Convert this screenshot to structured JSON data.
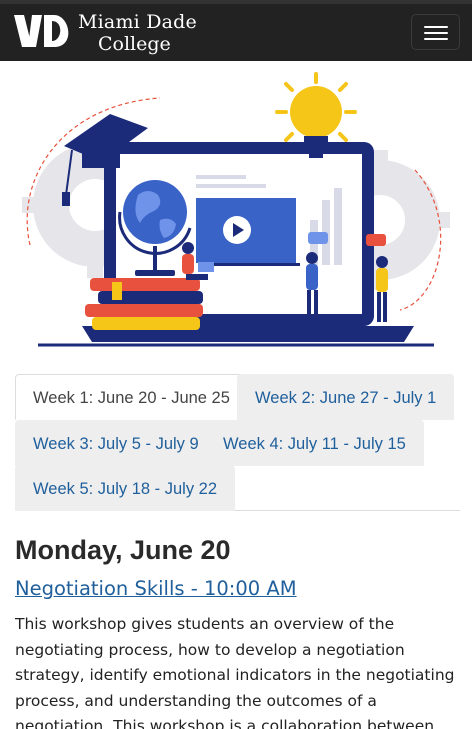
{
  "brand": {
    "name_line1": "Miami Dade",
    "name_line2": "College",
    "logo_icon": "mdc-logo"
  },
  "nav": {
    "toggle_icon": "hamburger-menu-icon"
  },
  "hero": {
    "image_icon": "online-learning-illustration"
  },
  "tabs": [
    {
      "label": "Week 1: June 20 - June 25",
      "active": true
    },
    {
      "label": "Week 2: June 27 - July 1",
      "active": false
    },
    {
      "label": "Week 3: July 5 - July 9",
      "active": false
    },
    {
      "label": "Week 4: July 11 - July 15",
      "active": false
    },
    {
      "label": "Week 5: July 18 - July 22",
      "active": false
    }
  ],
  "schedule": {
    "day_title": "Monday, June 20",
    "session_link": "Negotiation Skills - 10:00 AM",
    "description": "This workshop gives students an overview of the negotiating process, how to develop a negotiation strategy, identify emotional indicators in the negotiating process, and understanding the outcomes of a negotiation. This workshop is a collaboration between the Business"
  },
  "colors": {
    "navbar": "#222222",
    "link": "#1f5f9c",
    "tab_bg": "#eeeeee",
    "illustration_navy": "#1c2a7a",
    "illustration_blue": "#3a63c8",
    "illustration_yellow": "#f5c518",
    "illustration_red": "#e8513d"
  }
}
